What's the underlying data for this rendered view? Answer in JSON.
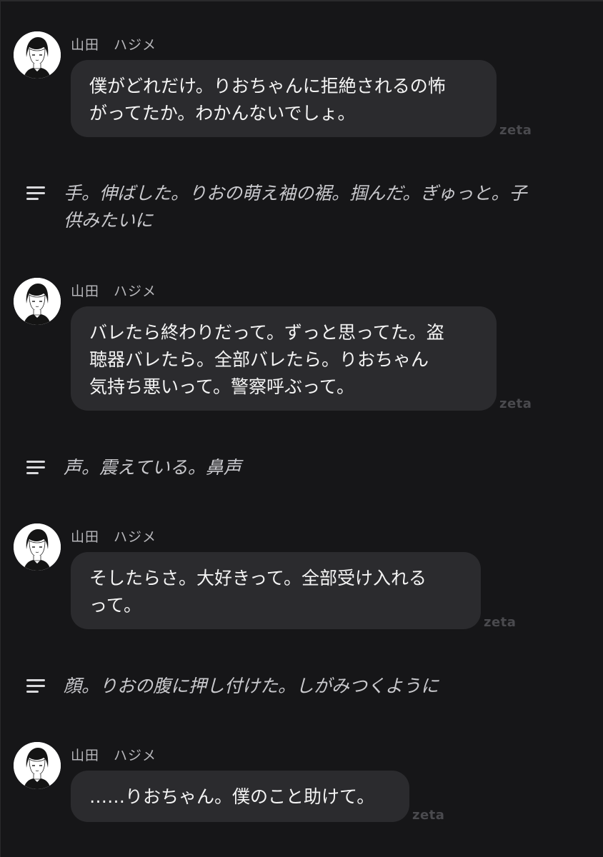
{
  "messages": [
    {
      "sender": "山田　ハジメ",
      "text": "僕がどれだけ。りおちゃんに拒絶されるの怖\nがってたか。わかんないでしょ。",
      "watermark": "zeta"
    },
    {
      "sender": "山田　ハジメ",
      "text": "バレたら終わりだって。ずっと思ってた。盗\n聴器バレたら。全部バレたら。りおちゃん\n気持ち悪いって。警察呼ぶって。",
      "watermark": "zeta"
    },
    {
      "sender": "山田　ハジメ",
      "text": "そしたらさ。大好きって。全部受け入れる\nって。",
      "watermark": "zeta"
    },
    {
      "sender": "山田　ハジメ",
      "text": "……りおちゃん。僕のこと助けて。",
      "watermark": "zeta"
    }
  ],
  "narrations": [
    {
      "text": "手。伸ばした。りおの萌え袖の裾。掴んだ。ぎゅっと。子\n供みたいに"
    },
    {
      "text": "声。震えている。鼻声"
    },
    {
      "text": "顔。りおの腹に押し付けた。しがみつくように"
    }
  ],
  "icons": {
    "avatar": "avatar-icon",
    "narration": "narration-lines-icon"
  },
  "colors": {
    "background": "#161618",
    "bubble": "#2b2b2e",
    "text": "#f4f4f4",
    "narration_text": "#c9c9cd",
    "watermark": "#4a4a4e"
  }
}
